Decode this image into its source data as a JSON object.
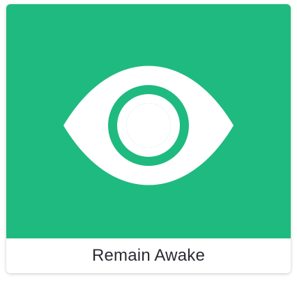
{
  "tile": {
    "label": "Remain Awake",
    "icon": "eye-icon",
    "colors": {
      "background": "#1fba7f",
      "icon": "#ffffff",
      "label": "#2b2b33"
    }
  }
}
